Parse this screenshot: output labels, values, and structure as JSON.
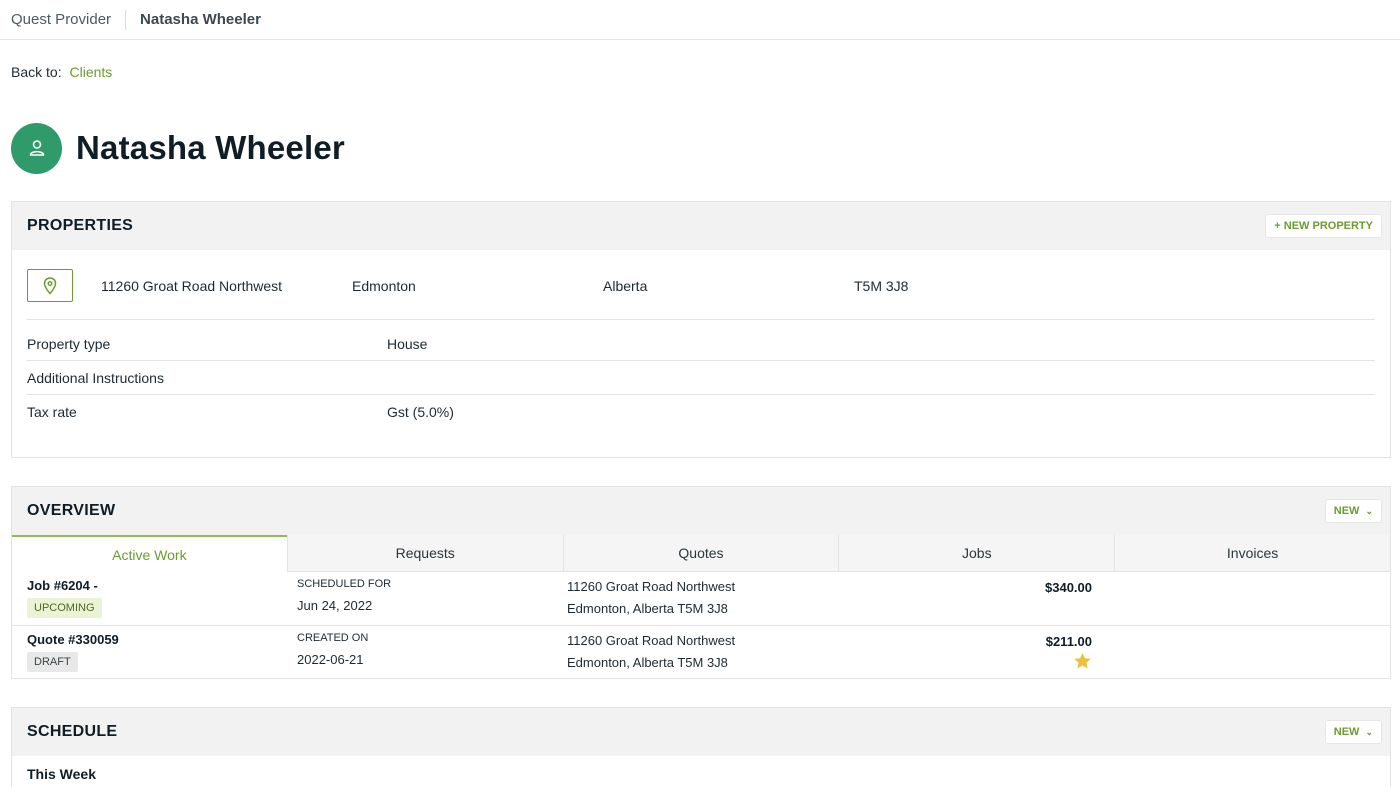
{
  "topbar": {
    "provider": "Quest Provider",
    "client": "Natasha Wheeler"
  },
  "back": {
    "label": "Back to:",
    "link": "Clients"
  },
  "client": {
    "name": "Natasha Wheeler",
    "icon": "person-icon"
  },
  "properties": {
    "title": "PROPERTIES",
    "new_button": "+ NEW PROPERTY",
    "address": {
      "street": "11260 Groat Road Northwest",
      "city": "Edmonton",
      "province": "Alberta",
      "postal": "T5M 3J8"
    },
    "details": [
      {
        "key": "Property type",
        "value": "House"
      },
      {
        "key": "Additional Instructions",
        "value": ""
      },
      {
        "key": "Tax rate",
        "value": "Gst (5.0%)"
      }
    ]
  },
  "overview": {
    "title": "OVERVIEW",
    "new_button": "NEW",
    "tabs": [
      "Active Work",
      "Requests",
      "Quotes",
      "Jobs",
      "Invoices"
    ],
    "rows": [
      {
        "title": "Job #6204 -",
        "badge": "UPCOMING",
        "date_label": "SCHEDULED FOR",
        "date": "Jun 24, 2022",
        "addr1": "11260 Groat Road Northwest",
        "addr2": "Edmonton, Alberta T5M 3J8",
        "amount": "$340.00"
      },
      {
        "title": "Quote #330059",
        "badge": "DRAFT",
        "date_label": "CREATED ON",
        "date": "2022-06-21",
        "addr1": "11260 Groat Road Northwest",
        "addr2": "Edmonton, Alberta T5M 3J8",
        "amount": "$211.00"
      }
    ]
  },
  "schedule": {
    "title": "SCHEDULE",
    "new_button": "NEW",
    "section": "This Week"
  },
  "colors": {
    "accent": "#6b9c2e",
    "avatar": "#2f9a6a",
    "star": "#e8c23a"
  }
}
